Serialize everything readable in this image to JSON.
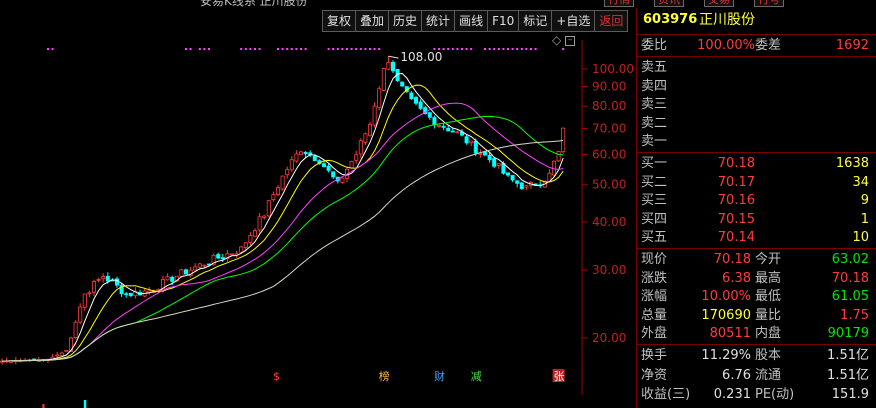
{
  "window": {
    "title_fragment": "安易K线系 正川股份"
  },
  "topbar": {
    "buttons": [
      "行情",
      "资讯",
      "交易",
      "行号"
    ]
  },
  "toolbar": {
    "buttons": [
      "复权",
      "叠加",
      "历史",
      "统计",
      "画线",
      "F10",
      "标记",
      "+自选",
      "返回"
    ]
  },
  "quote": {
    "code": "603976",
    "name": "正川股份",
    "weibi_label": "委比",
    "weibi": "100.00%",
    "weicha_label": "委差",
    "weicha": "1692",
    "sell_labels": [
      "卖五",
      "卖四",
      "卖三",
      "卖二",
      "卖一"
    ],
    "buy": [
      {
        "label": "买一",
        "price": "70.18",
        "vol": "1638"
      },
      {
        "label": "买二",
        "price": "70.17",
        "vol": "34"
      },
      {
        "label": "买三",
        "price": "70.16",
        "vol": "9"
      },
      {
        "label": "买四",
        "price": "70.15",
        "vol": "1"
      },
      {
        "label": "买五",
        "price": "70.14",
        "vol": "10"
      }
    ],
    "stats": [
      {
        "l1": "现价",
        "v1": "70.18",
        "c1": "red",
        "l2": "今开",
        "v2": "63.02",
        "c2": "grn"
      },
      {
        "l1": "涨跌",
        "v1": "6.38",
        "c1": "red",
        "l2": "最高",
        "v2": "70.18",
        "c2": "red"
      },
      {
        "l1": "涨幅",
        "v1": "10.00%",
        "c1": "red",
        "l2": "最低",
        "v2": "61.05",
        "c2": "grn"
      },
      {
        "l1": "总量",
        "v1": "170690",
        "c1": "yel",
        "l2": "量比",
        "v2": "1.75",
        "c2": "red"
      },
      {
        "l1": "外盘",
        "v1": "80511",
        "c1": "red",
        "l2": "内盘",
        "v2": "90179",
        "c2": "grn"
      }
    ],
    "extra": [
      {
        "l1": "换手",
        "v1": "11.29%",
        "l2": "股本",
        "v2": "1.51亿"
      },
      {
        "l1": "净资",
        "v1": "6.76",
        "l2": "流通",
        "v2": "1.51亿"
      },
      {
        "l1": "收益(三)",
        "v1": "0.231",
        "l2": "PE(动)",
        "v2": "151.9"
      }
    ]
  },
  "chart_data": {
    "type": "candlestick",
    "title": "",
    "ylim": [
      17,
      112
    ],
    "y_ticks": [
      20,
      30,
      40,
      50,
      60,
      70,
      80,
      90,
      100
    ],
    "y_tick_labels": [
      "20.00",
      "30.00",
      "40.00",
      "50.00",
      "60.00",
      "70.00",
      "80.00",
      "90.00",
      "100.00"
    ],
    "annotation": {
      "label": "108.00",
      "value": 108.0
    },
    "markers": [
      {
        "label": "$",
        "index": 60
      },
      {
        "label": "榜",
        "index": 83
      },
      {
        "label": "财",
        "index": 95
      },
      {
        "label": "减",
        "index": 103
      },
      {
        "label": "张",
        "index": 121
      }
    ],
    "colors": {
      "up": "#ff3c3c",
      "down": "#00ffff",
      "ma1": "#ffffff",
      "ma2": "#ffff00",
      "ma3": "#ff40ff",
      "ma4": "#00ff00",
      "ma5": "#d8d8c0",
      "axis": "#a00000",
      "dot": "#ff40ff"
    },
    "keypoints": [
      [
        0,
        17.4
      ],
      [
        10,
        17.6
      ],
      [
        14,
        18.5
      ],
      [
        18,
        26
      ],
      [
        22,
        29
      ],
      [
        27,
        26
      ],
      [
        32,
        26.5
      ],
      [
        38,
        29
      ],
      [
        46,
        32
      ],
      [
        52,
        34
      ],
      [
        57,
        42
      ],
      [
        62,
        55
      ],
      [
        65,
        62
      ],
      [
        69,
        58
      ],
      [
        73,
        50
      ],
      [
        77,
        60
      ],
      [
        80,
        72
      ],
      [
        82,
        90
      ],
      [
        84,
        108
      ],
      [
        86,
        92
      ],
      [
        89,
        82
      ],
      [
        92,
        76
      ],
      [
        95,
        72
      ],
      [
        99,
        68
      ],
      [
        103,
        62
      ],
      [
        107,
        57
      ],
      [
        110,
        52
      ],
      [
        114,
        49
      ],
      [
        117,
        51
      ],
      [
        119,
        53
      ],
      [
        121,
        61
      ],
      [
        122,
        70.18
      ]
    ]
  }
}
